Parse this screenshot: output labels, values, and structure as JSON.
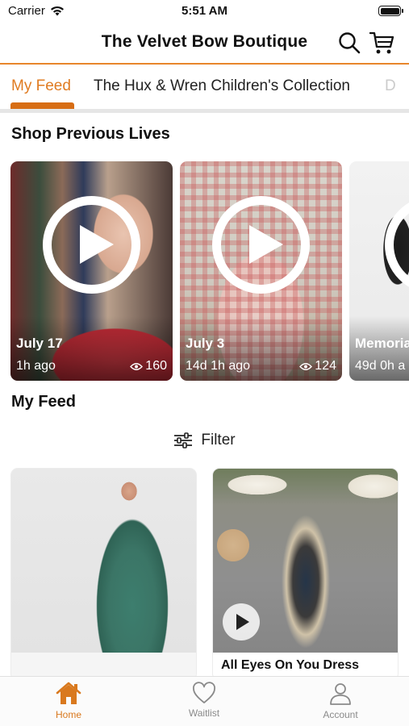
{
  "status_bar": {
    "carrier": "Carrier",
    "time": "5:51 AM"
  },
  "header": {
    "title": "The Velvet Bow Boutique",
    "search_icon": "search-icon",
    "cart_icon": "cart-icon"
  },
  "tabs": [
    {
      "label": "My Feed",
      "active": true
    },
    {
      "label": "The Hux & Wren Children's Collection",
      "active": false
    },
    {
      "label": "D",
      "active": false
    }
  ],
  "previous_lives": {
    "title": "Shop Previous Lives",
    "items": [
      {
        "date": "July 17",
        "ago": "1h ago",
        "views": "160"
      },
      {
        "date": "July 3",
        "ago": "14d 1h ago",
        "views": "124"
      },
      {
        "date": "Memoria",
        "ago": "49d 0h a",
        "views": ""
      }
    ]
  },
  "feed": {
    "title": "My Feed",
    "filter_label": "Filter",
    "products": [
      {
        "name": ""
      },
      {
        "name": "All Eyes On You Dress"
      }
    ]
  },
  "bottom_nav": [
    {
      "label": "Home",
      "icon": "home-icon",
      "active": true
    },
    {
      "label": "Waitlist",
      "icon": "heart-icon",
      "active": false
    },
    {
      "label": "Account",
      "icon": "account-icon",
      "active": false
    }
  ],
  "colors": {
    "accent": "#e07c22",
    "accent_dark": "#d76d14"
  }
}
